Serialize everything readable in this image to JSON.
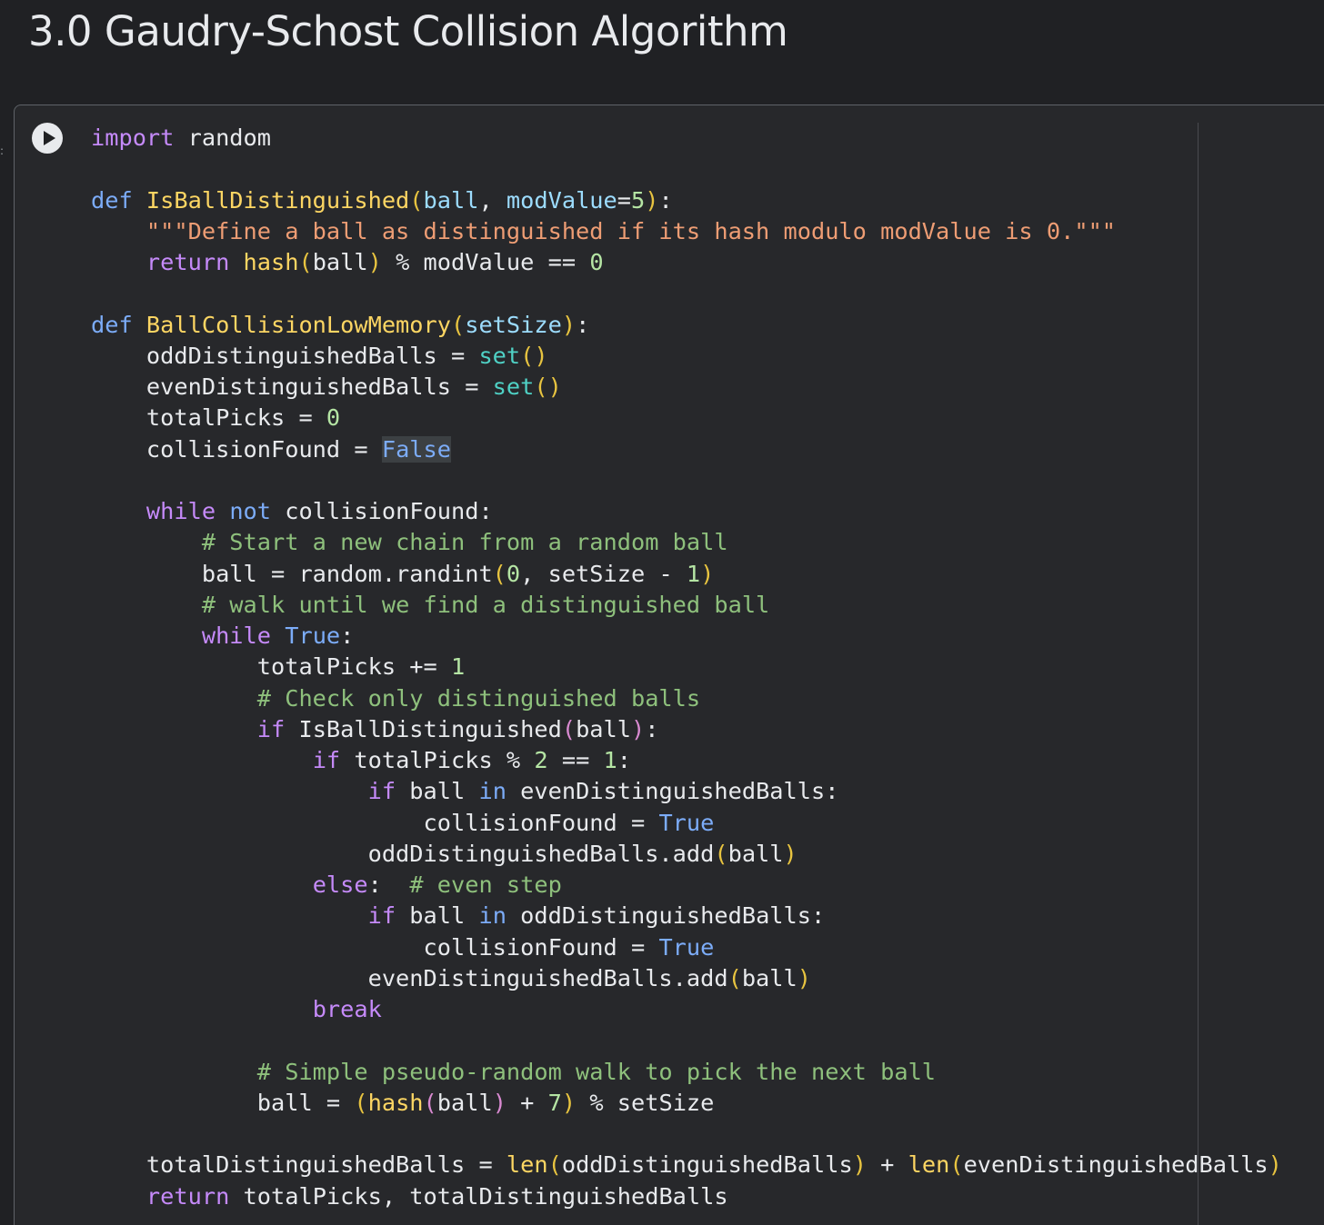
{
  "section": {
    "title": "3.0 Gaudry-Schost Collision Algorithm"
  },
  "cell": {
    "run_icon": "play-icon",
    "lines": [
      [
        {
          "t": "import",
          "c": "kw"
        },
        {
          "t": " random",
          "c": "txt"
        }
      ],
      [],
      [
        {
          "t": "def ",
          "c": "def"
        },
        {
          "t": "IsBallDistinguished",
          "c": "fn"
        },
        {
          "t": "(",
          "c": "par"
        },
        {
          "t": "ball",
          "c": "param"
        },
        {
          "t": ", ",
          "c": "txt"
        },
        {
          "t": "modValue",
          "c": "param"
        },
        {
          "t": "=",
          "c": "op"
        },
        {
          "t": "5",
          "c": "num"
        },
        {
          "t": ")",
          "c": "par"
        },
        {
          "t": ":",
          "c": "txt"
        }
      ],
      [
        {
          "t": "    ",
          "c": "txt"
        },
        {
          "t": "\"\"\"Define a ball as distinguished if its hash modulo modValue is 0.\"\"\"",
          "c": "str"
        }
      ],
      [
        {
          "t": "    ",
          "c": "txt"
        },
        {
          "t": "return",
          "c": "kw"
        },
        {
          "t": " ",
          "c": "txt"
        },
        {
          "t": "hash",
          "c": "fn"
        },
        {
          "t": "(",
          "c": "par"
        },
        {
          "t": "ball",
          "c": "txt"
        },
        {
          "t": ")",
          "c": "par"
        },
        {
          "t": " % modValue == ",
          "c": "txt"
        },
        {
          "t": "0",
          "c": "num"
        }
      ],
      [],
      [
        {
          "t": "def ",
          "c": "def"
        },
        {
          "t": "BallCollisionLowMemory",
          "c": "fn"
        },
        {
          "t": "(",
          "c": "par"
        },
        {
          "t": "setSize",
          "c": "param"
        },
        {
          "t": ")",
          "c": "par"
        },
        {
          "t": ":",
          "c": "txt"
        }
      ],
      [
        {
          "t": "    oddDistinguishedBalls = ",
          "c": "txt"
        },
        {
          "t": "set",
          "c": "bi"
        },
        {
          "t": "()",
          "c": "par"
        }
      ],
      [
        {
          "t": "    evenDistinguishedBalls = ",
          "c": "txt"
        },
        {
          "t": "set",
          "c": "bi"
        },
        {
          "t": "()",
          "c": "par"
        }
      ],
      [
        {
          "t": "    totalPicks = ",
          "c": "txt"
        },
        {
          "t": "0",
          "c": "num"
        }
      ],
      [
        {
          "t": "    collisionFound = ",
          "c": "txt"
        },
        {
          "t": "False",
          "c": "sel"
        }
      ],
      [],
      [
        {
          "t": "    ",
          "c": "txt"
        },
        {
          "t": "while",
          "c": "kw"
        },
        {
          "t": " ",
          "c": "txt"
        },
        {
          "t": "not",
          "c": "def"
        },
        {
          "t": " collisionFound:",
          "c": "txt"
        }
      ],
      [
        {
          "t": "        ",
          "c": "txt"
        },
        {
          "t": "# Start a new chain from a random ball",
          "c": "cm"
        }
      ],
      [
        {
          "t": "        ball = random.randint",
          "c": "txt"
        },
        {
          "t": "(",
          "c": "par"
        },
        {
          "t": "0",
          "c": "num"
        },
        {
          "t": ", setSize - ",
          "c": "txt"
        },
        {
          "t": "1",
          "c": "num"
        },
        {
          "t": ")",
          "c": "par"
        }
      ],
      [
        {
          "t": "        ",
          "c": "txt"
        },
        {
          "t": "# walk until we find a distinguished ball",
          "c": "cm"
        }
      ],
      [
        {
          "t": "        ",
          "c": "txt"
        },
        {
          "t": "while",
          "c": "kw"
        },
        {
          "t": " ",
          "c": "txt"
        },
        {
          "t": "True",
          "c": "const"
        },
        {
          "t": ":",
          "c": "txt"
        }
      ],
      [
        {
          "t": "            totalPicks += ",
          "c": "txt"
        },
        {
          "t": "1",
          "c": "num"
        }
      ],
      [
        {
          "t": "            ",
          "c": "txt"
        },
        {
          "t": "# Check only distinguished balls",
          "c": "cm"
        }
      ],
      [
        {
          "t": "            ",
          "c": "txt"
        },
        {
          "t": "if",
          "c": "kw"
        },
        {
          "t": " IsBallDistinguished",
          "c": "txt"
        },
        {
          "t": "(",
          "c": "par2"
        },
        {
          "t": "ball",
          "c": "txt"
        },
        {
          "t": ")",
          "c": "par2"
        },
        {
          "t": ":",
          "c": "txt"
        }
      ],
      [
        {
          "t": "                ",
          "c": "txt"
        },
        {
          "t": "if",
          "c": "kw"
        },
        {
          "t": " totalPicks % ",
          "c": "txt"
        },
        {
          "t": "2",
          "c": "num"
        },
        {
          "t": " == ",
          "c": "txt"
        },
        {
          "t": "1",
          "c": "num"
        },
        {
          "t": ":",
          "c": "txt"
        }
      ],
      [
        {
          "t": "                    ",
          "c": "txt"
        },
        {
          "t": "if",
          "c": "kw"
        },
        {
          "t": " ball ",
          "c": "txt"
        },
        {
          "t": "in",
          "c": "def"
        },
        {
          "t": " evenDistinguishedBalls:",
          "c": "txt"
        }
      ],
      [
        {
          "t": "                        collisionFound = ",
          "c": "txt"
        },
        {
          "t": "True",
          "c": "const"
        }
      ],
      [
        {
          "t": "                    oddDistinguishedBalls.add",
          "c": "txt"
        },
        {
          "t": "(",
          "c": "par"
        },
        {
          "t": "ball",
          "c": "txt"
        },
        {
          "t": ")",
          "c": "par"
        }
      ],
      [
        {
          "t": "                ",
          "c": "txt"
        },
        {
          "t": "else",
          "c": "kw"
        },
        {
          "t": ":  ",
          "c": "txt"
        },
        {
          "t": "# even step",
          "c": "cm"
        }
      ],
      [
        {
          "t": "                    ",
          "c": "txt"
        },
        {
          "t": "if",
          "c": "kw"
        },
        {
          "t": " ball ",
          "c": "txt"
        },
        {
          "t": "in",
          "c": "def"
        },
        {
          "t": " oddDistinguishedBalls:",
          "c": "txt"
        }
      ],
      [
        {
          "t": "                        collisionFound = ",
          "c": "txt"
        },
        {
          "t": "True",
          "c": "const"
        }
      ],
      [
        {
          "t": "                    evenDistinguishedBalls.add",
          "c": "txt"
        },
        {
          "t": "(",
          "c": "par"
        },
        {
          "t": "ball",
          "c": "txt"
        },
        {
          "t": ")",
          "c": "par"
        }
      ],
      [
        {
          "t": "                ",
          "c": "txt"
        },
        {
          "t": "break",
          "c": "kw"
        }
      ],
      [],
      [
        {
          "t": "            ",
          "c": "txt"
        },
        {
          "t": "# Simple pseudo-random walk to pick the next ball",
          "c": "cm"
        }
      ],
      [
        {
          "t": "            ball = ",
          "c": "txt"
        },
        {
          "t": "(",
          "c": "par"
        },
        {
          "t": "hash",
          "c": "fn"
        },
        {
          "t": "(",
          "c": "par2"
        },
        {
          "t": "ball",
          "c": "txt"
        },
        {
          "t": ")",
          "c": "par2"
        },
        {
          "t": " + ",
          "c": "txt"
        },
        {
          "t": "7",
          "c": "num"
        },
        {
          "t": ")",
          "c": "par"
        },
        {
          "t": " % setSize",
          "c": "txt"
        }
      ],
      [],
      [
        {
          "t": "    totalDistinguishedBalls = ",
          "c": "txt"
        },
        {
          "t": "len",
          "c": "fn"
        },
        {
          "t": "(",
          "c": "par"
        },
        {
          "t": "oddDistinguishedBalls",
          "c": "txt"
        },
        {
          "t": ")",
          "c": "par"
        },
        {
          "t": " + ",
          "c": "txt"
        },
        {
          "t": "len",
          "c": "fn"
        },
        {
          "t": "(",
          "c": "par"
        },
        {
          "t": "evenDistinguishedBalls",
          "c": "txt"
        },
        {
          "t": ")",
          "c": "par"
        }
      ],
      [
        {
          "t": "    ",
          "c": "txt"
        },
        {
          "t": "return",
          "c": "kw"
        },
        {
          "t": " totalPicks, totalDistinguishedBalls",
          "c": "txt"
        }
      ]
    ]
  },
  "colors": {
    "background": "#202124",
    "cell_background": "#27282b",
    "keyword": "#c58af9",
    "def_keyword": "#7cacf8",
    "function": "#fdd663",
    "string": "#ee9d74",
    "number": "#b5e5a4",
    "comment": "#8ec07c",
    "builtin": "#4fd1c5",
    "text": "#e8eaed"
  }
}
